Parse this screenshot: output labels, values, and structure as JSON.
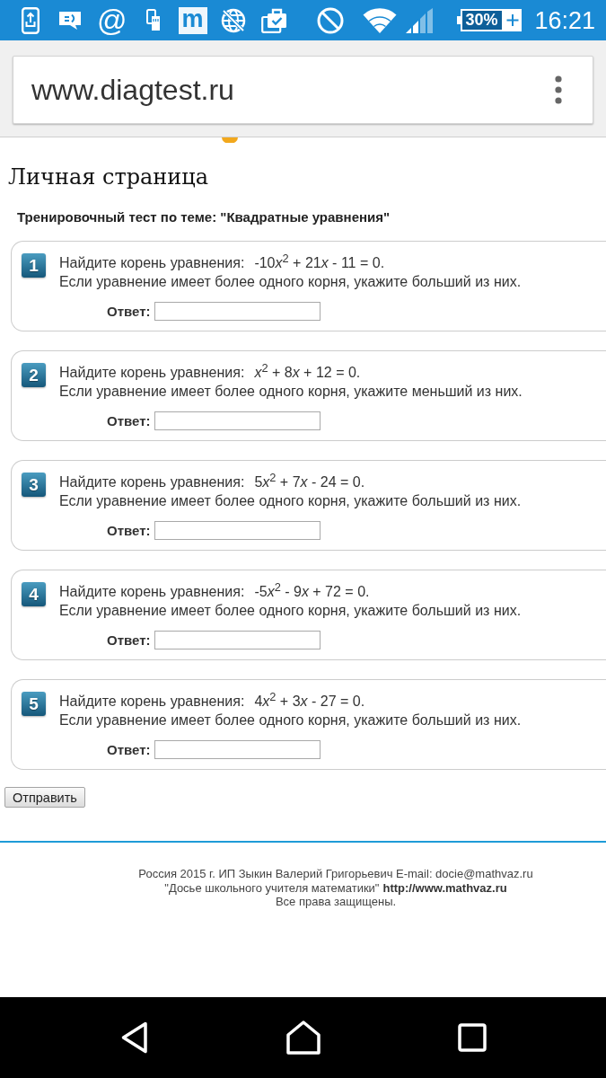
{
  "status_bar": {
    "at_sign": "@",
    "app_letter": "m",
    "battery": "30%",
    "time": "16:21"
  },
  "browser": {
    "url": "www.diagtest.ru"
  },
  "page": {
    "title": "Личная страница",
    "subtitle": "Тренировочный тест по теме: \"Квадратные уравнения\""
  },
  "questions": [
    {
      "number": "1",
      "prompt": "Найдите корень уравнения:",
      "equation": [
        {
          "text": "-10",
          "italic": false
        },
        {
          "text": "x",
          "italic": true
        },
        {
          "text": "$^{2}$ + 21",
          "italic": false
        },
        {
          "text": "x",
          "italic": true
        },
        {
          "text": " - 11 = 0.",
          "italic": false
        }
      ],
      "note": "Если уравнение имеет более одного корня, укажите больший из них.",
      "answer_label": "Ответ:"
    },
    {
      "number": "2",
      "prompt": "Найдите корень уравнения:",
      "equation": [
        {
          "text": "x",
          "italic": true
        },
        {
          "text": "$^{2}$ + 8",
          "italic": false
        },
        {
          "text": "x",
          "italic": true
        },
        {
          "text": " + 12 = 0.",
          "italic": false
        }
      ],
      "note": "Если уравнение имеет более одного корня, укажите меньший из них.",
      "answer_label": "Ответ:"
    },
    {
      "number": "3",
      "prompt": "Найдите корень уравнения:",
      "equation": [
        {
          "text": "5",
          "italic": false
        },
        {
          "text": "x",
          "italic": true
        },
        {
          "text": "$^{2}$ + 7",
          "italic": false
        },
        {
          "text": "x",
          "italic": true
        },
        {
          "text": " - 24 = 0.",
          "italic": false
        }
      ],
      "note": "Если уравнение имеет более одного корня, укажите больший из них.",
      "answer_label": "Ответ:"
    },
    {
      "number": "4",
      "prompt": "Найдите корень уравнения:",
      "equation": [
        {
          "text": "-5",
          "italic": false
        },
        {
          "text": "x",
          "italic": true
        },
        {
          "text": "$^{2}$ - 9",
          "italic": false
        },
        {
          "text": "x",
          "italic": true
        },
        {
          "text": " + 72 = 0.",
          "italic": false
        }
      ],
      "note": "Если уравнение имеет более одного корня, укажите больший из них.",
      "answer_label": "Ответ:"
    },
    {
      "number": "5",
      "prompt": "Найдите корень уравнения:",
      "equation": [
        {
          "text": "4",
          "italic": false
        },
        {
          "text": "x",
          "italic": true
        },
        {
          "text": "$^{2}$ + 3",
          "italic": false
        },
        {
          "text": "x",
          "italic": true
        },
        {
          "text": " - 27 = 0.",
          "italic": false
        }
      ],
      "note": "Если уравнение имеет более одного корня, укажите больший из них.",
      "answer_label": "Ответ:"
    }
  ],
  "submit_button": "Отправить",
  "footer": {
    "credits": "Россия 2015 г. ИП Зыкин Валерий Григорьевич E-mail: docie@mathvaz.ru",
    "site_name": "\"Досье школьного учителя математики\"",
    "site_link": "http://www.mathvaz.ru",
    "rights": "Все права защищены."
  }
}
